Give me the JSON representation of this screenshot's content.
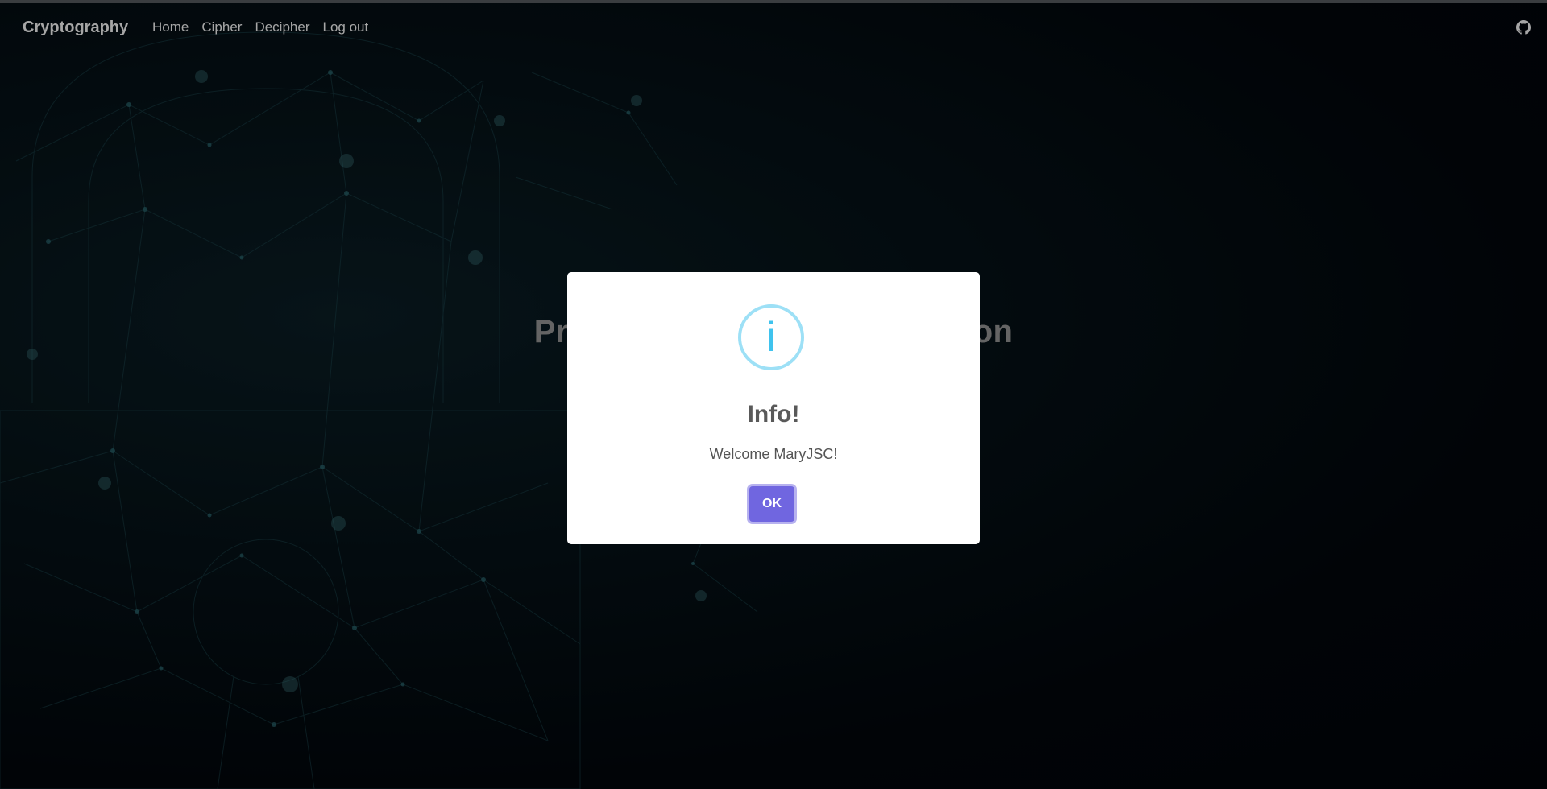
{
  "navbar": {
    "brand": "Cryptography",
    "links": [
      "Home",
      "Cipher",
      "Decipher",
      "Log out"
    ],
    "github_icon": "github-icon"
  },
  "hero": {
    "title": "Pr                                            on"
  },
  "modal": {
    "icon": "info-icon",
    "icon_glyph": "i",
    "title": "Info!",
    "text": "Welcome MaryJSC!",
    "ok_label": "OK",
    "accent_color": "#7066e0",
    "icon_color": "#3fc3ee"
  }
}
